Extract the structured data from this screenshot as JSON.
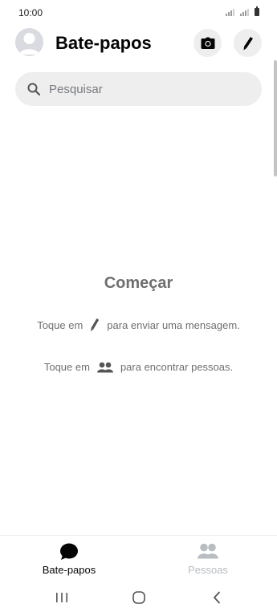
{
  "status_bar": {
    "time": "10:00"
  },
  "header": {
    "title": "Bate-papos"
  },
  "search": {
    "placeholder": "Pesquisar"
  },
  "empty_state": {
    "title": "Começar",
    "hint_compose_before": "Toque em",
    "hint_compose_after": "para enviar uma mensagem.",
    "hint_people_before": "Toque em",
    "hint_people_after": "para encontrar pessoas."
  },
  "tabs": [
    {
      "label": "Bate-papos",
      "icon": "chat-bubble-icon",
      "active": true
    },
    {
      "label": "Pessoas",
      "icon": "people-icon",
      "active": false
    }
  ],
  "colors": {
    "text_primary": "#050505",
    "text_muted": "#6f6f6f",
    "inactive": "#b9bcc1",
    "surface": "#eeeeee"
  }
}
